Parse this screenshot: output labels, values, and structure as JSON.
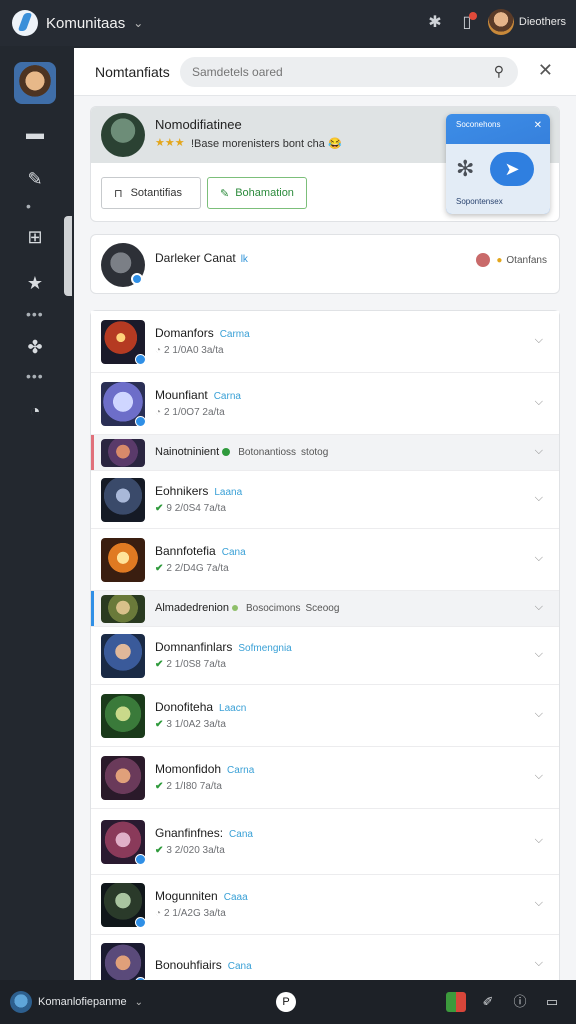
{
  "app": {
    "title": "Komunitaas",
    "title_chevron": "⌄",
    "user_name": "Dieothers"
  },
  "panel": {
    "title": "Nomtanfiats",
    "search_placeholder": "Samdetels oared"
  },
  "featured": {
    "name": "Nomodifiatinee",
    "stars": "★★★",
    "description": "!Base morenisters bont cha 😂",
    "button_1": "Sotantifias",
    "button_2": "Bohamation",
    "popup_title": "Soconehons",
    "popup_label": "Sopontensex"
  },
  "channel": {
    "name": "Darleker Canat",
    "tag": "lk",
    "meta": "Otanfans"
  },
  "rows": [
    {
      "type": "item",
      "name": "Domanfors",
      "tag": "Carma",
      "sub": "2 1/0A0 3a/ta",
      "status": "gray"
    },
    {
      "type": "item",
      "name": "Mounfiant",
      "tag": "Carna",
      "sub": "2 1/0O7 2a/ta",
      "status": "gray"
    },
    {
      "type": "section",
      "name": "Nainotninient",
      "info": "Botonantioss",
      "extra": "stotog"
    },
    {
      "type": "item",
      "name": "Eohnikers",
      "tag": "Laana",
      "sub": "9 2/0S4 7a/ta",
      "status": "ok"
    },
    {
      "type": "item",
      "name": "Bannfotefia",
      "tag": "Cana",
      "sub": "2 2/D4G 7a/ta",
      "status": "ok"
    },
    {
      "type": "section",
      "name": "Almadedrenion",
      "info": "Bosocimons",
      "extra": "Sceoog"
    },
    {
      "type": "item",
      "name": "Domnanfinlars",
      "tag": "Sofmengnia",
      "sub": "2 1/0S8 7a/ta",
      "status": "ok"
    },
    {
      "type": "item",
      "name": "Donofiteha",
      "tag": "Laacn",
      "sub": "3 1/0A2 3a/ta",
      "status": "ok"
    },
    {
      "type": "item",
      "name": "Momonfidoh",
      "tag": "Carna",
      "sub": "2 1/I80 7a/ta",
      "status": "ok"
    },
    {
      "type": "item",
      "name": "Gnanfinfnes:",
      "tag": "Cana",
      "sub": "3 2/020 3a/ta",
      "status": "ok"
    },
    {
      "type": "item",
      "name": "Mogunniten",
      "tag": "Caaa",
      "sub": "2 1/A2G 3a/ta",
      "status": "gray"
    },
    {
      "type": "item",
      "name": "Bonouhfiairs",
      "tag": "Cana",
      "sub": "",
      "status": "gray"
    }
  ],
  "bottom": {
    "user_name": "Komanlofiepanme",
    "center_label": "P"
  },
  "colors": {
    "accent_blue": "#2f8fe6",
    "ok_green": "#2f9a3c",
    "section_red": "#e0707a",
    "section_blue": "#2f8fe6"
  }
}
